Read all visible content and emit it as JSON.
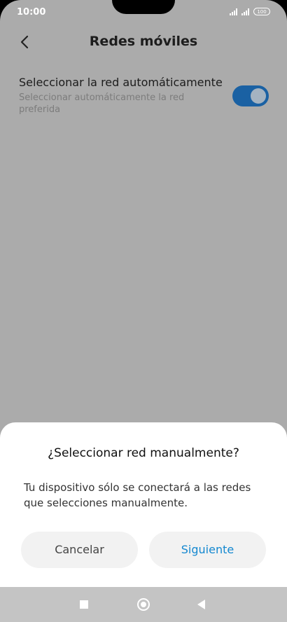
{
  "status_bar": {
    "time": "10:00",
    "battery": "100"
  },
  "header": {
    "title": "Redes móviles"
  },
  "setting": {
    "title": "Seleccionar la red automáticamente",
    "subtitle": "Seleccionar automáticamente la red preferida",
    "enabled": true
  },
  "dialog": {
    "title": "¿Seleccionar red manualmente?",
    "message": "Tu dispositivo sólo se conectará a las redes que selecciones manualmente.",
    "cancel_label": "Cancelar",
    "next_label": "Siguiente"
  },
  "colors": {
    "accent": "#1488d0",
    "toggle_on": "#1a61a3"
  },
  "icons": {
    "back": "chevron-left-icon",
    "nav_recent": "square-icon",
    "nav_home": "circle-icon",
    "nav_back": "triangle-left-icon"
  }
}
